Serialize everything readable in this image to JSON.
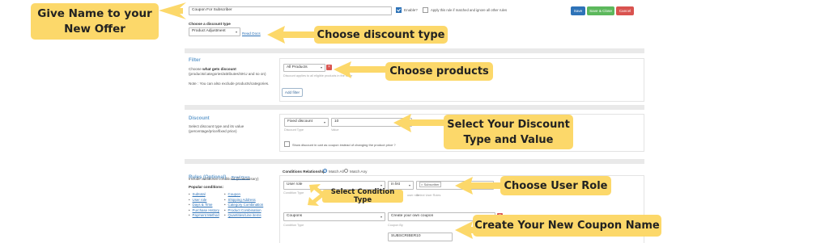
{
  "header": {
    "offer_name_value": "Coupon For Subscriber",
    "enable_label": "Enable?",
    "apply_rule_label": "Apply this rule if matched and ignore all other rules",
    "save_label": "Save",
    "save_close_label": "Save & Close",
    "cancel_label": "Cancel",
    "discount_type_heading": "Choose a discount type",
    "discount_type_value": "Product Adjustment",
    "read_docs_label": "Read Docs"
  },
  "filter": {
    "title": "Filter",
    "desc_prefix": "Choose ",
    "desc_bold": "what gets discount",
    "desc_suffix": "(products/categories/attributes/SKU and so on)",
    "note": "Note : You can also exclude products/categories.",
    "products_value": "All Products",
    "products_hint": "Discount applies to all eligible products in the store",
    "add_filter_label": "Add filter"
  },
  "discount": {
    "title": "Discount",
    "desc": "Select discount type and its value (percentage/price/fixed price)",
    "type_value": "Fixed discount",
    "type_hint": "Discount Type",
    "value": "10",
    "value_hint": "Value",
    "show_in_cart_label": "Show discount in cart as coupon instead of changing the product price ?"
  },
  "rules": {
    "title": "Rules (Optional)",
    "read_docs_label": "Read Docs",
    "desc": "Include additional conditions (if necessary)",
    "popular_heading": "Popular conditions:",
    "col1": [
      "Subtotal",
      "User role",
      "Days & Time",
      "Purchase History",
      "Payment Method"
    ],
    "col2": [
      "Coupon",
      "Shipping Address",
      "Category Combination",
      "Product Combination",
      "Quantities/Line items"
    ],
    "relationship_label": "Conditions Relationship",
    "match_all_label": "Match All",
    "match_any_label": "Match Any",
    "condition1_value": "User role",
    "condition1_hint": "Condition Type",
    "operator_value": "in list",
    "operator_hint": "user role",
    "roles_value": "× Subscriber",
    "roles_hint": "Select User Roles",
    "condition2_value": "Coupons",
    "condition2_hint": "Condition Type",
    "coupon_mode_value": "Create your own coupon",
    "coupon_mode_hint": "Coupon By",
    "coupon_code_value": "SUBSCRIBER10"
  },
  "callouts": {
    "give_name_line1": "Give Name to your",
    "give_name_line2": "New Offer",
    "choose_discount_type": "Choose discount type",
    "choose_products": "Choose products",
    "select_discount_line1": "Select Your Discount",
    "select_discount_line2": "Type and Value",
    "select_condition_type": "Select Condition Type",
    "choose_user_role": "Choose User Role",
    "create_coupon_name": "Create Your New Coupon Name"
  },
  "colors": {
    "callout_bg": "#fcd86a",
    "primary": "#2e73b8",
    "success": "#5cb85c",
    "danger": "#d9534f",
    "section_title": "#6aa0cf"
  }
}
